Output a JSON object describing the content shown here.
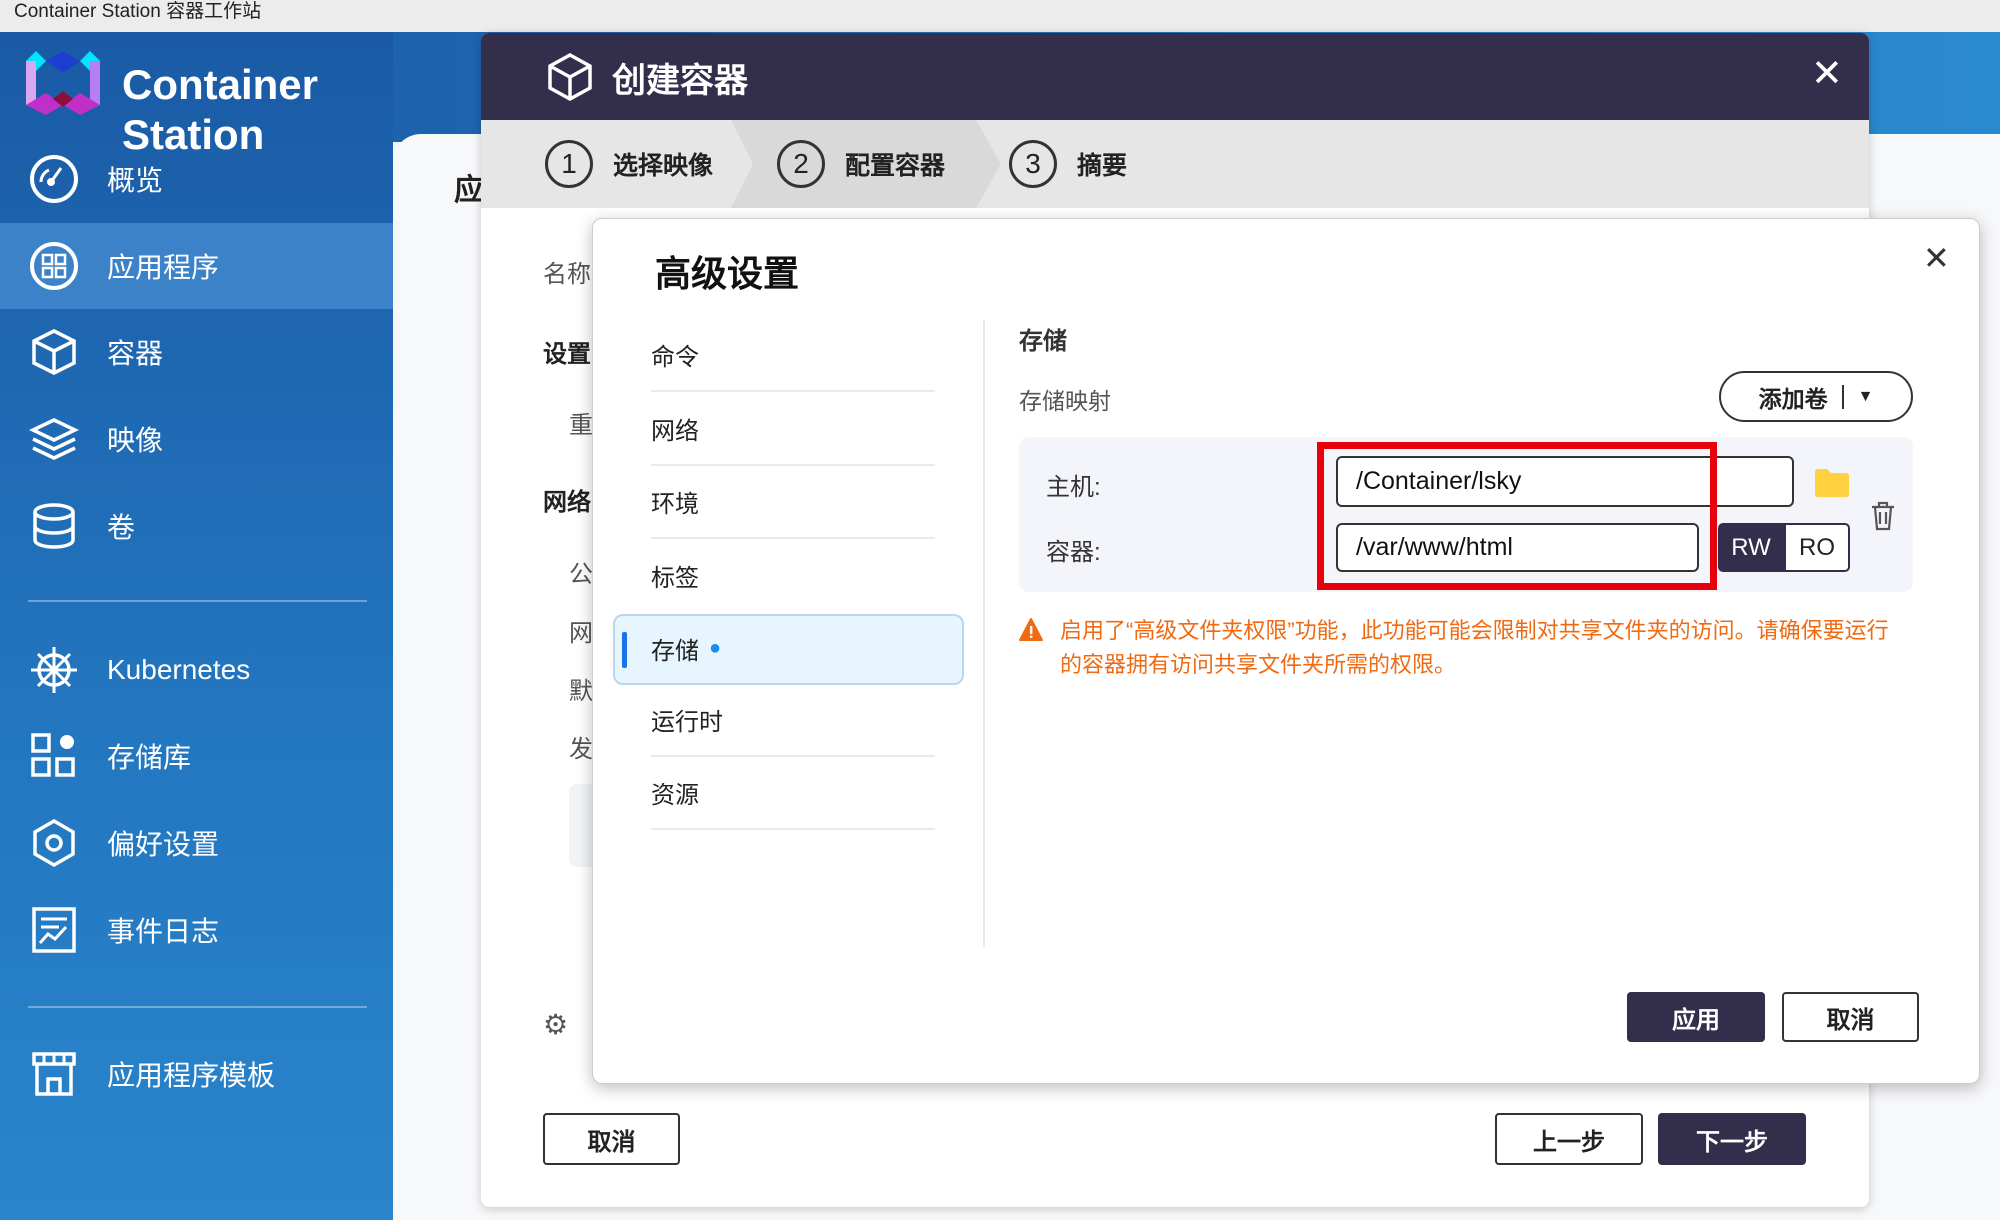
{
  "window_title": "Container Station 容器工作站",
  "sidebar": {
    "brand": "Container Station",
    "items": [
      {
        "label": "概览",
        "icon": "gauge-icon"
      },
      {
        "label": "应用程序",
        "icon": "apps-icon",
        "active": true
      },
      {
        "label": "容器",
        "icon": "cube-icon"
      },
      {
        "label": "映像",
        "icon": "layers-icon"
      },
      {
        "label": "卷",
        "icon": "database-icon"
      },
      {
        "label": "Kubernetes",
        "icon": "helm-icon"
      },
      {
        "label": "存储库",
        "icon": "grid-icon"
      },
      {
        "label": "偏好设置",
        "icon": "gear-icon"
      },
      {
        "label": "事件日志",
        "icon": "log-icon"
      },
      {
        "label": "应用程序模板",
        "icon": "store-icon"
      }
    ]
  },
  "background_page": {
    "title_fragment": "应",
    "labels": [
      "名称",
      "设置",
      "重",
      "网络",
      "公",
      "网",
      "默",
      "发"
    ],
    "gear_text_fragment": "Ī"
  },
  "create_dialog": {
    "title": "创建容器",
    "steps": [
      {
        "number": "1",
        "label": "选择映像"
      },
      {
        "number": "2",
        "label": "配置容器",
        "current": true
      },
      {
        "number": "3",
        "label": "摘要"
      }
    ],
    "cancel_label": "取消",
    "prev_label": "上一步",
    "next_label": "下一步"
  },
  "advanced_dialog": {
    "title": "高级设置",
    "menu": [
      "命令",
      "网络",
      "环境",
      "标签",
      "存储",
      "运行时",
      "资源"
    ],
    "active_menu": "存储",
    "section_title": "存储",
    "mapping_label": "存储映射",
    "add_volume_label": "添加卷",
    "host_label": "主机:",
    "host_value": "/Container/lsky",
    "container_label": "容器:",
    "container_value": "/var/www/html",
    "rw_label": "RW",
    "ro_label": "RO",
    "rw_selected": true,
    "warning_line1": "启用了“高级文件夹权限”功能，此功能可能会限制对共享文件夹的访问。请确保要运行",
    "warning_line2": "的容器拥有访问共享文件夹所需的权限。",
    "apply_label": "应用",
    "cancel_label": "取消"
  },
  "colors": {
    "header": "#322e4b",
    "highlight": "#e8000b",
    "warning": "#f06a12",
    "folder": "#ffd03f"
  }
}
